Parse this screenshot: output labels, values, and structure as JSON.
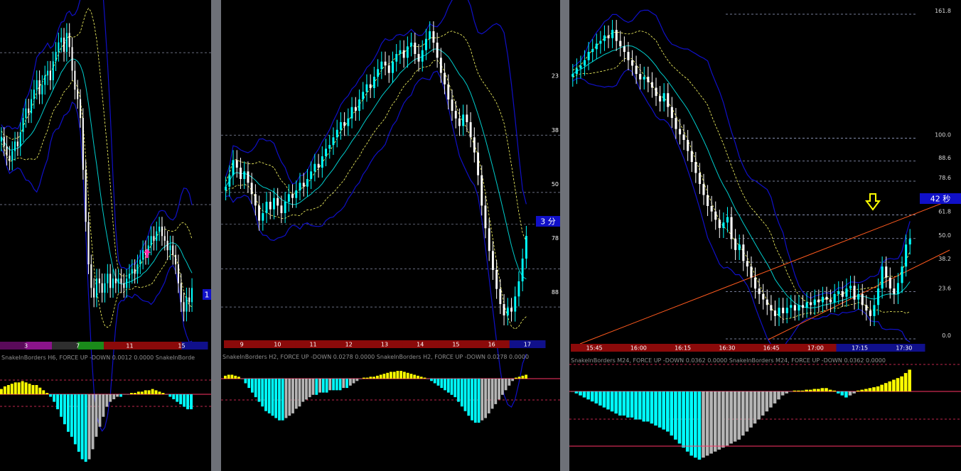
{
  "colors": {
    "background": "#000000",
    "separator": "#6e7178",
    "bull_candle": "#00ffff",
    "bear_candle": "#ffffff",
    "middle_band": "#00cccc",
    "outer_band": "#1010c8",
    "inner_band": "#ffff66",
    "hist_up": "#ffff00",
    "hist_down": "#00ffff",
    "hist_neutral": "#b5b5b5",
    "signal_line": "#ff3366",
    "channel": "#ff5a1e",
    "badge": "#1010c8"
  },
  "chart_data": [
    {
      "name": "H6",
      "type": "candlestick",
      "series": [
        {
          "name": "price",
          "values": [
            62,
            60,
            58,
            57,
            59,
            61,
            60,
            63,
            66,
            68,
            67,
            70,
            72,
            74,
            71,
            73,
            75,
            76,
            74,
            78,
            80,
            82,
            83,
            80,
            84,
            81,
            76,
            72,
            70,
            66,
            55,
            44,
            35,
            30,
            28,
            32,
            31,
            29,
            31,
            33,
            30,
            32,
            31,
            32,
            31,
            30,
            32,
            33,
            34,
            33,
            35,
            36,
            38,
            37,
            39,
            41,
            40,
            42,
            43,
            41,
            40,
            38,
            39,
            37,
            35,
            31,
            27,
            25,
            28,
            27,
            30
          ]
        }
      ],
      "time_labels": [
        "3",
        "7",
        "11",
        "15"
      ],
      "time_strip_colors": [
        "#5a0a5a",
        "#8b148b",
        "#2e2e2e",
        "#1a8a1a",
        "#8b0a0a",
        "#8b0a0a",
        "#8b0a0a",
        "#10108b"
      ],
      "axis_badge": "1",
      "annotations": [
        {
          "type": "arrow-up",
          "color": "#ff2fa8"
        }
      ],
      "indicator": {
        "title": "SnakeInBorders H6, FORCE UP -DOWN  0.0012 0.0000   SnakeInBorde",
        "values": [
          4,
          6,
          7,
          8,
          9,
          9,
          10,
          9,
          8,
          7,
          7,
          5,
          3,
          1,
          -1,
          -3,
          -6,
          -9,
          -12,
          -15,
          -17,
          -20,
          -23,
          -26,
          -27,
          -26,
          -22,
          -17,
          -13,
          -9,
          -5,
          -3,
          -2,
          -1,
          -1,
          0,
          0,
          1,
          1,
          2,
          2,
          3,
          3,
          4,
          3,
          2,
          1,
          0,
          -1,
          -2,
          -3,
          -4,
          -5,
          -6,
          -6
        ]
      }
    },
    {
      "name": "H2",
      "type": "candlestick",
      "series": [
        {
          "name": "price",
          "values": [
            55,
            58,
            62,
            60,
            57,
            59,
            56,
            53,
            50,
            46,
            48,
            51,
            49,
            52,
            50,
            48,
            51,
            53,
            52,
            54,
            56,
            55,
            57,
            59,
            61,
            60,
            63,
            65,
            66,
            68,
            70,
            72,
            71,
            73,
            76,
            75,
            78,
            80,
            82,
            81,
            84,
            86,
            88,
            87,
            85,
            88,
            90,
            91,
            89,
            92,
            93,
            90,
            88,
            91,
            94,
            96,
            93,
            89,
            85,
            82,
            78,
            75,
            73,
            71,
            74,
            72,
            68,
            64,
            58,
            50,
            44,
            38,
            33,
            28,
            24,
            21,
            23,
            22,
            26,
            30,
            36,
            42
          ]
        }
      ],
      "time_labels": [
        "9",
        "10",
        "11",
        "12",
        "13",
        "14",
        "15",
        "16",
        "17"
      ],
      "time_strip_colors": [
        "#8b0a0a",
        "#8b0a0a",
        "#8b0a0a",
        "#8b0a0a",
        "#8b0a0a",
        "#8b0a0a",
        "#8b0a0a",
        "#8b0a0a",
        "#10108b"
      ],
      "axis_labels": [
        "23",
        "38",
        "50",
        "78",
        "88"
      ],
      "axis_badge": "3 分",
      "indicator": {
        "title": "SnakeInBorders H2, FORCE UP -DOWN  0.0278 0.0000   SnakeInBorders H2, FORCE UP -DOWN  0.0278 0.0000",
        "values": [
          3,
          4,
          4,
          3,
          2,
          0,
          -2,
          -4,
          -6,
          -8,
          -10,
          -12,
          -14,
          -15,
          -16,
          -17,
          -18,
          -18,
          -17,
          -16,
          -15,
          -13,
          -12,
          -10,
          -9,
          -8,
          -7,
          -7,
          -6,
          -6,
          -6,
          -5,
          -5,
          -5,
          -5,
          -4,
          -4,
          -3,
          -2,
          -1,
          0,
          1,
          1,
          2,
          2,
          3,
          4,
          5,
          6,
          7,
          7,
          8,
          8,
          7,
          6,
          5,
          4,
          3,
          2,
          1,
          0,
          -1,
          -2,
          -3,
          -4,
          -5,
          -6,
          -7,
          -8,
          -10,
          -12,
          -14,
          -16,
          -18,
          -19,
          -19,
          -18,
          -17,
          -15,
          -13,
          -11,
          -9,
          -7,
          -5,
          -3,
          -1,
          1,
          2,
          3,
          4
        ]
      }
    },
    {
      "name": "M24",
      "type": "candlestick",
      "series": [
        {
          "name": "price",
          "values": [
            140,
            142,
            143,
            145,
            148,
            149,
            151,
            152,
            154,
            153,
            156,
            152,
            150,
            148,
            145,
            143,
            140,
            138,
            139,
            137,
            135,
            132,
            130,
            133,
            128,
            124,
            120,
            118,
            116,
            112,
            108,
            104,
            100,
            96,
            92,
            90,
            87,
            84,
            86,
            88,
            80,
            76,
            78,
            72,
            70,
            66,
            62,
            60,
            58,
            56,
            54,
            52,
            55,
            53,
            55,
            56,
            54,
            56,
            55,
            57,
            56,
            58,
            57,
            59,
            58,
            57,
            60,
            61,
            59,
            62,
            63,
            58,
            60,
            56,
            54,
            52,
            56,
            62,
            70,
            66,
            62,
            60,
            64,
            70,
            78,
            80
          ]
        }
      ],
      "time_labels": [
        "15:45",
        "16:00",
        "16:15",
        "16:30",
        "16:45",
        "17:00",
        "17:15",
        "17:30"
      ],
      "time_strip_colors": [
        "#8b0a0a",
        "#8b0a0a",
        "#8b0a0a",
        "#8b0a0a",
        "#8b0a0a",
        "#8b0a0a",
        "#10108b",
        "#10108b"
      ],
      "fibonacci": [
        {
          "label": "161.8",
          "level": 161.8
        },
        {
          "label": "100.0",
          "level": 100
        },
        {
          "label": "88.6",
          "level": 88.6
        },
        {
          "label": "78.6",
          "level": 78.6
        },
        {
          "label": "61.8",
          "level": 61.8
        },
        {
          "label": "50.0",
          "level": 50
        },
        {
          "label": "38.2",
          "level": 38.2
        },
        {
          "label": "23.6",
          "level": 23.6
        },
        {
          "label": "0.0",
          "level": 0
        }
      ],
      "axis_badge": "42 秒",
      "annotations": [
        {
          "type": "arrow-down",
          "color": "#ffff00"
        }
      ],
      "indicator": {
        "title": "SnakeInBorders M24, FORCE UP -DOWN  0.0362 0.0000   SnakeInBorders M24, FORCE UP -DOWN  0.0362 0.0000",
        "values": [
          0,
          -1,
          -2,
          -3,
          -4,
          -5,
          -6,
          -7,
          -8,
          -9,
          -10,
          -11,
          -12,
          -12,
          -13,
          -13,
          -14,
          -14,
          -15,
          -15,
          -16,
          -17,
          -18,
          -19,
          -20,
          -22,
          -24,
          -26,
          -28,
          -30,
          -32,
          -33,
          -34,
          -33,
          -32,
          -31,
          -30,
          -29,
          -28,
          -27,
          -26,
          -25,
          -24,
          -22,
          -20,
          -18,
          -16,
          -14,
          -12,
          -10,
          -8,
          -6,
          -4,
          -2,
          -1,
          0,
          1,
          1,
          1,
          2,
          2,
          3,
          3,
          4,
          4,
          2,
          1,
          -1,
          -2,
          -3,
          -2,
          -1,
          1,
          2,
          3,
          4,
          5,
          6,
          8,
          10,
          12,
          14,
          16,
          18,
          22,
          26
        ]
      }
    }
  ]
}
